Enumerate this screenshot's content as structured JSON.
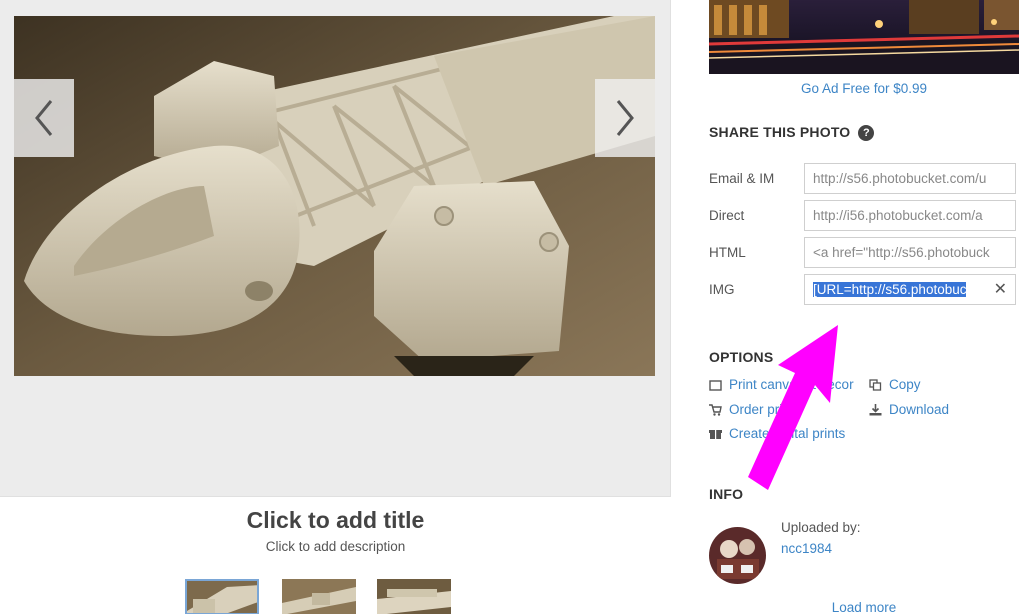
{
  "viewer": {
    "prev_icon": "chevron-left-icon",
    "next_icon": "chevron-right-icon",
    "title": "Click to add title",
    "description": "Click to add description"
  },
  "sidebar": {
    "ad_free_link": "Go Ad Free for $0.99",
    "share": {
      "heading": "SHARE THIS PHOTO",
      "help_glyph": "?",
      "rows": [
        {
          "label": "Email & IM",
          "value": "http://s56.photobucket.com/u"
        },
        {
          "label": "Direct",
          "value": "http://i56.photobucket.com/a"
        },
        {
          "label": "HTML",
          "value": "<a href=\"http://s56.photobuck"
        },
        {
          "label": "IMG",
          "value": "[URL=http://s56.photobuc"
        }
      ],
      "clear_glyph": "✕"
    },
    "options": {
      "heading": "OPTIONS",
      "items": [
        {
          "label": "Print canvas & decor",
          "icon": "canvas-icon"
        },
        {
          "label": "Order prints",
          "icon": "cart-icon"
        },
        {
          "label": "Create digital prints",
          "icon": "gift-icon"
        },
        {
          "label": "Copy",
          "icon": "copy-icon"
        },
        {
          "label": "Download",
          "icon": "download-icon"
        }
      ]
    },
    "info": {
      "heading": "INFO",
      "uploaded_by_label": "Uploaded by:",
      "uploader": "ncc1984",
      "load_more": "Load more"
    }
  },
  "colors": {
    "link": "#3d85c6",
    "annotation_arrow": "#ff00ff",
    "selection": "#3875d7"
  }
}
